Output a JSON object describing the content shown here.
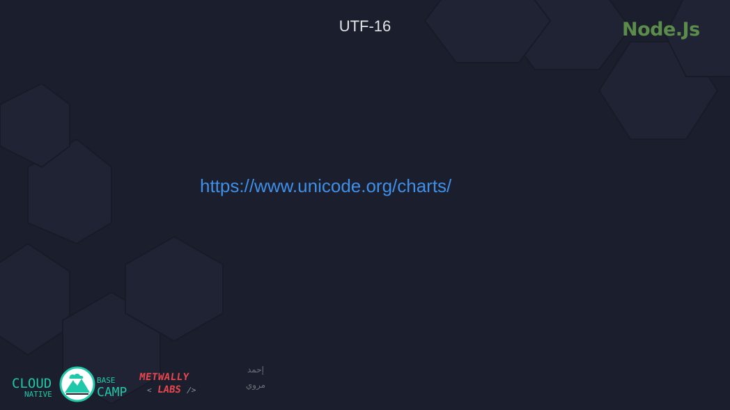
{
  "slide": {
    "title": "UTF-16",
    "link_text": "https://www.unicode.org/charts/",
    "brand": "Node.Js"
  },
  "footer": {
    "cloud_native_basecamp": {
      "cloud": "CLOUD",
      "native": "NATIVE",
      "base": "BASE",
      "camp": "CAMP"
    },
    "metwally_labs": {
      "top": "METWALLY",
      "bottom": "LABS",
      "open_bracket": "<",
      "close_bracket": "/>"
    },
    "signature": {
      "line1": "إحمد",
      "line2": "مروي"
    }
  },
  "colors": {
    "background": "#1b1f2d",
    "title": "#e2e3e6",
    "brand": "#5b8c4a",
    "link": "#3f8fe8",
    "teal": "#1fc8a8",
    "red": "#e8474e"
  },
  "icons": [
    "cloud-native-basecamp-logo",
    "metwally-labs-logo",
    "signature-logo"
  ]
}
